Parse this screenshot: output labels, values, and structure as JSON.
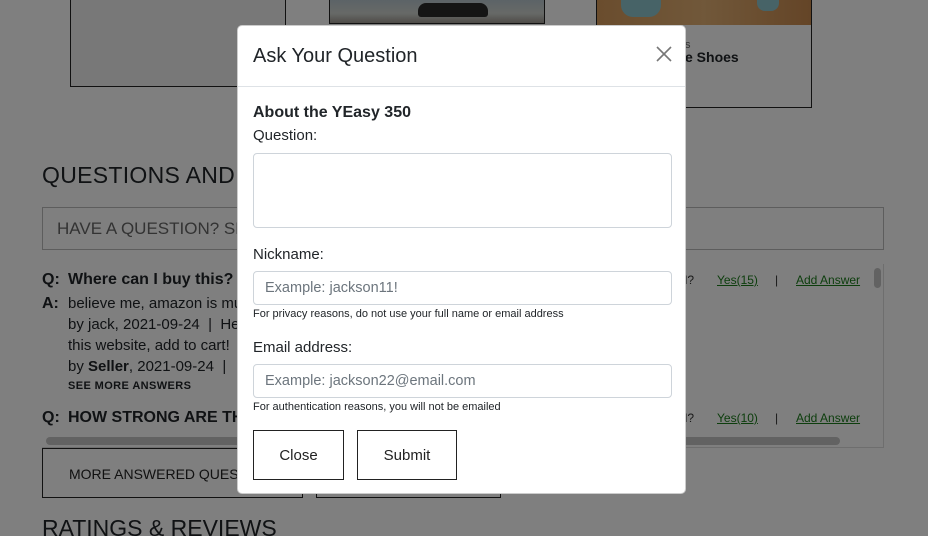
{
  "background": {
    "card3_category": "s",
    "card3_name": "e Shoes",
    "qa_heading": "QUESTIONS AND",
    "search_placeholder": "HAVE A QUESTION? SE",
    "questions": [
      {
        "q_label": "Q:",
        "text": "Where can I buy this?",
        "helpful_label": "ul?",
        "yes_label": "Yes(15)",
        "separator": "|",
        "add_answer": "Add Answer"
      },
      {
        "q_label": "Q:",
        "text": "HOW STRONG ARE TH",
        "helpful_label": "ul?",
        "yes_label": "Yes(10)",
        "separator": "|",
        "add_answer": "Add Answer"
      }
    ],
    "answer": {
      "a_label": "A:",
      "line1": "believe me, amazon is muc",
      "line2_prefix": "by jack, 2021-09-24",
      "line2_sep": "|",
      "line2_suffix": "He",
      "line3": "this website, add to cart!",
      "line4_prefix": "by",
      "line4_seller": "Seller",
      "line4_suffix": ", 2021-09-24",
      "line4_sep": "|"
    },
    "see_more": "SEE MORE ANSWERS",
    "more_button": "MORE ANSWERED QUEST",
    "ratings_heading": "RATINGS & REVIEWS"
  },
  "modal": {
    "title": "Ask Your Question",
    "subtitle": "About the YEasy 350",
    "question_label": "Question:",
    "question_value": "",
    "nickname_label": "Nickname:",
    "nickname_placeholder": "Example: jackson11!",
    "nickname_help": "For privacy reasons, do not use your full name or email address",
    "email_label": "Email address:",
    "email_placeholder": "Example: jackson22@email.com",
    "email_help": "For authentication reasons, you will not be emailed",
    "close_button": "Close",
    "submit_button": "Submit"
  },
  "icons": {
    "close": "close-icon"
  },
  "colors": {
    "overlay": "#000000",
    "link_green": "#1a7c1a",
    "border": "#222222"
  }
}
